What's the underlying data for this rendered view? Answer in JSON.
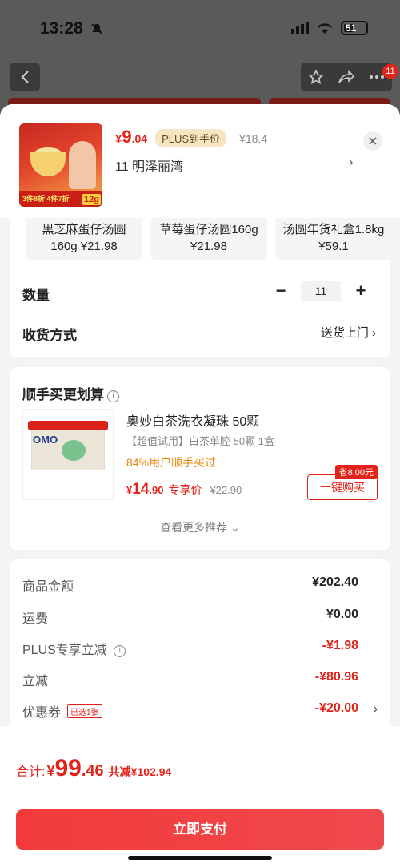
{
  "status": {
    "time": "13:28",
    "battery": "51"
  },
  "nav": {
    "badge": "11"
  },
  "product": {
    "image_banner": "3件8折 4件7折",
    "image_tag": "12g",
    "price_yen": "¥",
    "price_int": "9",
    "price_dec": ".04",
    "plus_tag": "PLUS到手价",
    "orig_price": "¥18.4",
    "qty_addr": "11  明泽丽湾",
    "addr_arrow": "›"
  },
  "variants": [
    {
      "line1": "黑芝麻蛋仔汤圆",
      "line2": "160g ¥21.98"
    },
    {
      "line1": "草莓蛋仔汤圆160g",
      "line2": "¥21.98"
    },
    {
      "line1": "汤圆年货礼盒1.8kg",
      "line2": "¥59.1"
    }
  ],
  "quantity": {
    "label": "数量",
    "minus": "−",
    "value": "11",
    "plus": "+"
  },
  "delivery": {
    "label": "收货方式",
    "value": "送货上门 ›"
  },
  "recommend": {
    "title": "顺手买更划算",
    "info": "i",
    "name": "奥妙白茶洗衣凝珠 50颗",
    "spec": "【超值试用】白茶单腔  50颗 1盒",
    "buyers": "84%用户顺手买过",
    "price_yen": "¥",
    "price_int": "14",
    "price_dec": ".90",
    "price_label": "专享价",
    "orig_price": "¥22.90",
    "save_tag": "省8.00元",
    "buy_btn": "一键购买",
    "see_more": "查看更多推荐 ⌄"
  },
  "summary": {
    "rows": [
      {
        "label": "商品金额",
        "value": "¥202.40"
      },
      {
        "label": "运费",
        "value": "¥0.00"
      },
      {
        "label": "PLUS专享立减",
        "value": "-¥1.98"
      },
      {
        "label": "立减",
        "value": "-¥80.96"
      },
      {
        "label": "优惠券",
        "value": "-¥20.00"
      }
    ],
    "coupon_tag": "已选1张",
    "info": "i",
    "arrow": "›"
  },
  "footer": {
    "total_label": "合计:",
    "total_yen": "¥",
    "total_int": "99",
    "total_dec": ".46",
    "total_save": "共减¥102.94",
    "pay_btn": "立即支付"
  },
  "colors": {
    "accent": "#e2231a",
    "orange": "#e8860c"
  }
}
